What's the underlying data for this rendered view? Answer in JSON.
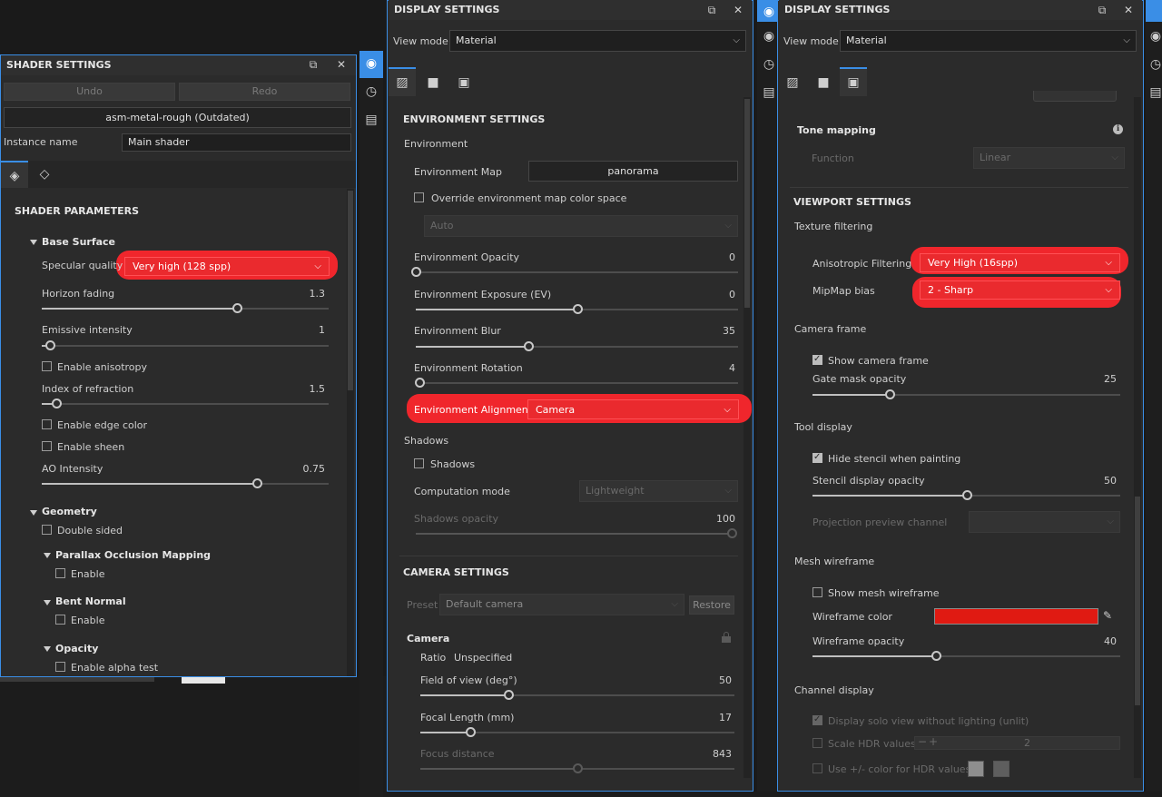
{
  "shader": {
    "title": "SHADER SETTINGS",
    "undo": "Undo",
    "redo": "Redo",
    "material": "asm-metal-rough (Outdated)",
    "instance_label": "Instance name",
    "instance_value": "Main shader",
    "section": "SHADER PARAMETERS",
    "base_surface": "Base Surface",
    "specular_label": "Specular quality",
    "specular_value": "Very high (128 spp)",
    "horizon_label": "Horizon fading",
    "horizon_value": "1.3",
    "emissive_label": "Emissive intensity",
    "emissive_value": "1",
    "anisotropy": "Enable anisotropy",
    "ior_label": "Index of refraction",
    "ior_value": "1.5",
    "edge_color": "Enable edge color",
    "sheen": "Enable sheen",
    "ao_label": "AO Intensity",
    "ao_value": "0.75",
    "geometry": "Geometry",
    "double_sided": "Double sided",
    "pom": "Parallax Occlusion Mapping",
    "pom_enable": "Enable",
    "bent": "Bent Normal",
    "bent_enable": "Enable",
    "opacity": "Opacity",
    "alpha_test": "Enable alpha test",
    "sliders": {
      "horizon": 0.68,
      "emissive": 0.03,
      "ior": 0.05,
      "ao": 0.75
    }
  },
  "display1": {
    "title": "DISPLAY SETTINGS",
    "view_mode_label": "View mode",
    "view_mode_value": "Material",
    "env_section": "ENVIRONMENT SETTINGS",
    "env_group": "Environment",
    "env_map_label": "Environment Map",
    "env_map_value": "panorama",
    "override_cs": "Override environment map color space",
    "auto": "Auto",
    "opacity_label": "Environment Opacity",
    "opacity_value": "0",
    "exposure_label": "Environment Exposure (EV)",
    "exposure_value": "0",
    "blur_label": "Environment Blur",
    "blur_value": "35",
    "rotation_label": "Environment Rotation",
    "rotation_value": "4",
    "alignment_label": "Environment Alignment",
    "alignment_value": "Camera",
    "shadows_group": "Shadows",
    "shadows_cb": "Shadows",
    "computation_label": "Computation mode",
    "computation_value": "Lightweight",
    "shadow_opacity_label": "Shadows opacity",
    "shadow_opacity_value": "100",
    "camera_section": "CAMERA SETTINGS",
    "preset_label": "Preset",
    "preset_value": "Default camera",
    "restore": "Restore",
    "camera_group": "Camera",
    "ratio_label": "Ratio",
    "ratio_value": "Unspecified",
    "fov_label": "Field of view (deg°)",
    "fov_value": "50",
    "focal_label": "Focal Length (mm)",
    "focal_value": "17",
    "focus_label": "Focus distance",
    "focus_value": "843",
    "sliders": {
      "opacity": 0.0,
      "exposure": 0.5,
      "blur": 0.35,
      "rotation": 0.01,
      "shadow_opacity": 1.0,
      "fov": 0.28,
      "focal": 0.16,
      "focus": 0.5
    }
  },
  "display2": {
    "title": "DISPLAY SETTINGS",
    "view_mode_label": "View mode",
    "view_mode_value": "Material",
    "tone_label": "Tone mapping",
    "function_label": "Function",
    "function_value": "Linear",
    "viewport_section": "VIEWPORT SETTINGS",
    "texture_group": "Texture filtering",
    "aniso_label": "Anisotropic Filtering",
    "aniso_value": "Very High (16spp)",
    "mipmap_label": "MipMap bias",
    "mipmap_value": "2 - Sharp",
    "camera_frame_group": "Camera frame",
    "show_camera_frame": "Show camera frame",
    "gate_label": "Gate mask opacity",
    "gate_value": "25",
    "tool_group": "Tool display",
    "hide_stencil": "Hide stencil when painting",
    "stencil_label": "Stencil display opacity",
    "stencil_value": "50",
    "projection_label": "Projection preview channel",
    "wire_group": "Mesh wireframe",
    "show_wire": "Show mesh wireframe",
    "wire_color_label": "Wireframe color",
    "wire_color": "#e01a12",
    "wire_opacity_label": "Wireframe opacity",
    "wire_opacity_value": "40",
    "channel_group": "Channel display",
    "solo_view": "Display solo view without lighting (unlit)",
    "scale_hdr": "Scale HDR values",
    "scale_hdr_value": "2",
    "pm_color": "Use +/- color for HDR values",
    "sliders": {
      "gate": 0.25,
      "stencil": 0.5,
      "wire": 0.4
    }
  },
  "icons": {
    "undock": "⧉",
    "close": "✕",
    "chevron": "⌵",
    "info": "ℹ",
    "lock": "🔒",
    "globe": "◉",
    "history": "◷",
    "log": "▤",
    "env": "▨",
    "cam": "■",
    "frame": "▣",
    "shader": "◈",
    "geom": "◇",
    "picker": "✎"
  }
}
